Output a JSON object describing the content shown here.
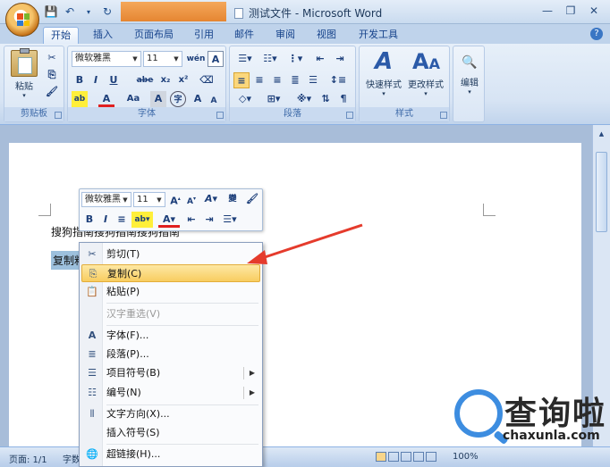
{
  "window": {
    "title": "测试文件 - Microsoft Word",
    "controls": [
      "—",
      "❐",
      "✕"
    ]
  },
  "tabs": [
    "开始",
    "插入",
    "页面布局",
    "引用",
    "邮件",
    "审阅",
    "视图",
    "开发工具"
  ],
  "ribbon": {
    "clipboard": {
      "label": "剪贴板",
      "paste": "粘贴"
    },
    "font": {
      "label": "字体",
      "font_name": "微软雅黑",
      "font_size": "11",
      "bold": "B",
      "italic": "I",
      "underline": "U",
      "strike": "abe",
      "subscript": "x₂",
      "superscript": "x²",
      "change_case": "Aa",
      "grow": "A",
      "shrink": "A",
      "wen": "wén",
      "char_border": "A"
    },
    "paragraph": {
      "label": "段落"
    },
    "styles": {
      "label": "样式",
      "quick_styles": "快速样式",
      "change_styles": "更改样式"
    },
    "editing": {
      "label": "编辑"
    }
  },
  "document": {
    "line1": "搜狗指南搜狗指南搜狗指南",
    "line2": "复制粘"
  },
  "mini_toolbar": {
    "font_name": "微软雅黑",
    "font_size": "11"
  },
  "context_menu": {
    "items": [
      {
        "label": "剪切(T)",
        "icon": "scissors-icon"
      },
      {
        "label": "复制(C)",
        "icon": "copy-icon"
      },
      {
        "label": "粘贴(P)",
        "icon": "paste-icon"
      },
      {
        "label": "汉字重选(V)",
        "icon": ""
      },
      {
        "label": "字体(F)...",
        "icon": "font-icon"
      },
      {
        "label": "段落(P)...",
        "icon": "paragraph-icon"
      },
      {
        "label": "项目符号(B)",
        "icon": "bullets-icon"
      },
      {
        "label": "编号(N)",
        "icon": "numbering-icon"
      },
      {
        "label": "文字方向(X)...",
        "icon": "text-direction-icon"
      },
      {
        "label": "插入符号(S)",
        "icon": ""
      },
      {
        "label": "超链接(H)...",
        "icon": "hyperlink-icon"
      }
    ]
  },
  "statusbar": {
    "page": "页面: 1/1",
    "words": "字数",
    "zoom": "100%"
  },
  "watermark": {
    "brand": "查询啦",
    "site": "chaxunla.com"
  },
  "colors": {
    "accent": "#3d8de0",
    "highlight": "#f8cd60",
    "selection": "#9dc0dd",
    "arrow": "#e53b2c"
  }
}
